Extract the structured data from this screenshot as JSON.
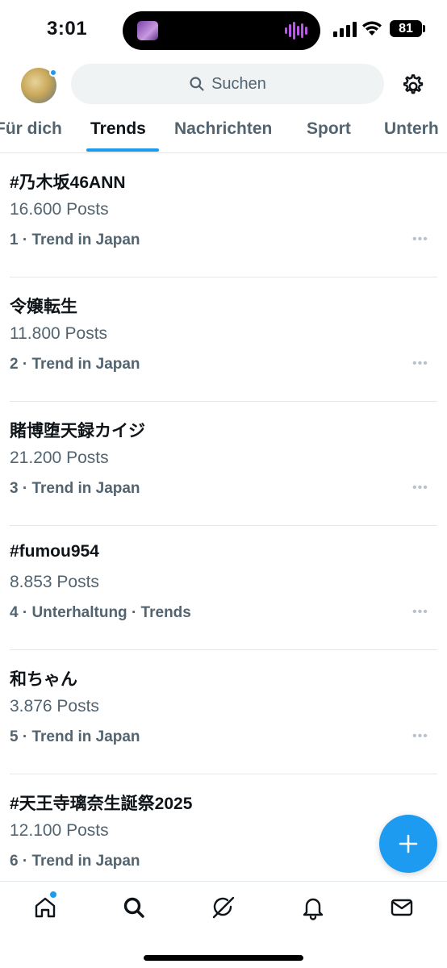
{
  "status_bar": {
    "time": "3:01",
    "battery": "81",
    "icons": [
      "signal-icon",
      "wifi-icon",
      "battery-icon"
    ]
  },
  "header": {
    "search_placeholder": "Suchen",
    "icons": [
      "avatar",
      "search-icon",
      "settings-gear-icon"
    ]
  },
  "tabs": [
    {
      "label": "Für dich"
    },
    {
      "label": "Trends"
    },
    {
      "label": "Nachrichten"
    },
    {
      "label": "Sport"
    },
    {
      "label": "Unterh"
    }
  ],
  "trends": [
    {
      "title": "#乃木坂46ANN",
      "posts": "16.600 Posts",
      "meta": "1 · Trend in Japan"
    },
    {
      "title": "令嬢転生",
      "posts": "11.800 Posts",
      "meta": "2 · Trend in Japan"
    },
    {
      "title": "賭博堕天録カイジ",
      "posts": "21.200 Posts",
      "meta": "3 · Trend in Japan"
    },
    {
      "title": "#fumou954",
      "posts": "8.853 Posts",
      "meta": "4 · Unterhaltung · Trends"
    },
    {
      "title": "和ちゃん",
      "posts": "3.876 Posts",
      "meta": "5 · Trend in Japan"
    },
    {
      "title": "#天王寺璃奈生誕祭2025",
      "posts": "12.100 Posts",
      "meta": "6 · Trend in Japan"
    }
  ],
  "more_glyph": "•••",
  "fab_glyph": "+",
  "bottom_nav": [
    "home-icon",
    "search-icon",
    "grok-icon",
    "notifications-bell-icon",
    "messages-envelope-icon"
  ],
  "colors": {
    "accent": "#1d9bf0",
    "text": "#0f1419",
    "muted": "#536471"
  }
}
